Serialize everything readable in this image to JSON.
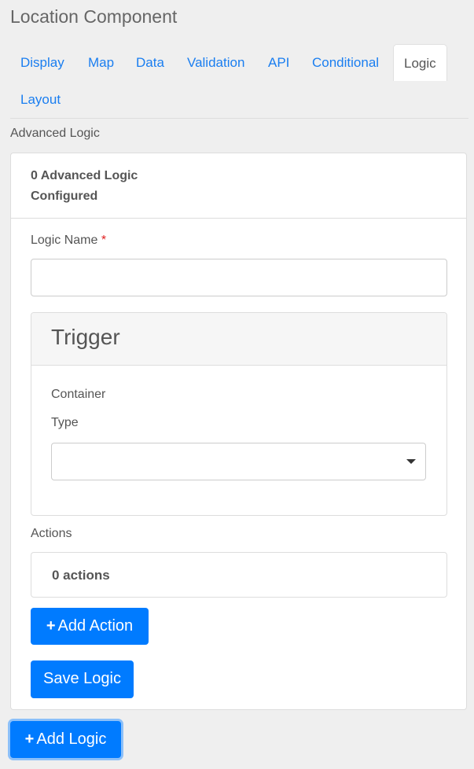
{
  "header": {
    "title": "Location Component"
  },
  "tabs": [
    {
      "label": "Display",
      "active": false
    },
    {
      "label": "Map",
      "active": false
    },
    {
      "label": "Data",
      "active": false
    },
    {
      "label": "Validation",
      "active": false
    },
    {
      "label": "API",
      "active": false
    },
    {
      "label": "Conditional",
      "active": false
    },
    {
      "label": "Logic",
      "active": true
    },
    {
      "label": "Layout",
      "active": false
    }
  ],
  "section": {
    "label": "Advanced Logic"
  },
  "card": {
    "count_text": "0 Advanced Logic Configured",
    "logic_name_label": "Logic Name",
    "required_marker": "*",
    "logic_name_value": "",
    "trigger": {
      "title": "Trigger",
      "container_label": "Container",
      "type_label": "Type",
      "type_value": ""
    },
    "actions_label": "Actions",
    "actions_count": "0 actions",
    "add_action_label": "Add Action",
    "save_logic_label": "Save Logic"
  },
  "add_logic_label": "Add Logic",
  "icons": {
    "plus": "+"
  },
  "colors": {
    "primary": "#007bff",
    "link": "#1a7ef0",
    "required": "#e02020"
  }
}
